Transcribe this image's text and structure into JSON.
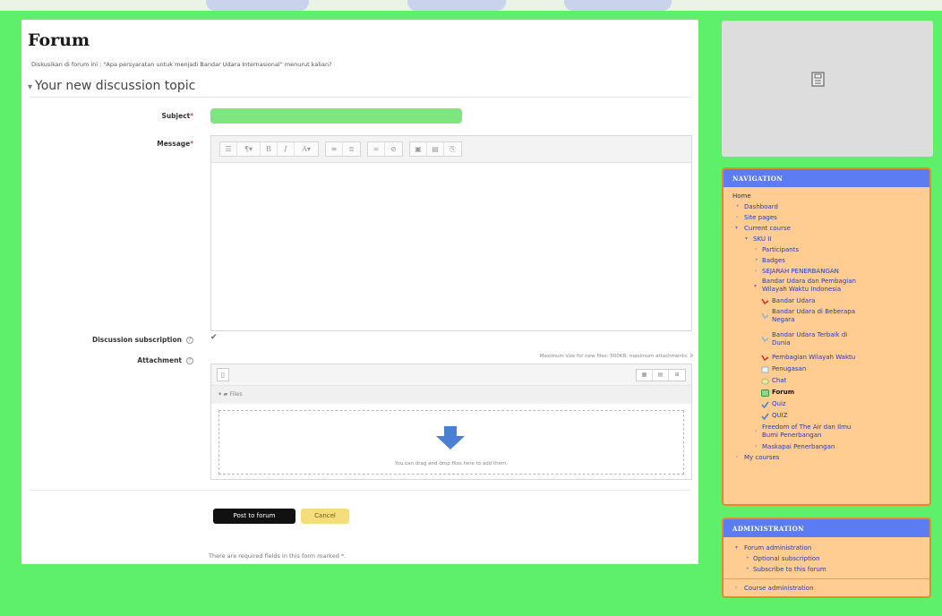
{
  "page": {
    "title": "Forum",
    "intro": "Diskusikan di forum ini : \"Apa persyaratan untuk menjadi Bandar Udara Internasional\" menurut kalian?",
    "section_title": "Your new discussion topic"
  },
  "form": {
    "subject_label": "Subject",
    "subject_value": "",
    "message_label": "Message",
    "required_marker": "*",
    "subscription_label": "Discussion subscription",
    "subscription_checked": true,
    "subscription_check_glyph": "✔",
    "attachment_label": "Attachment",
    "attachment_limits": "Maximum size for new files: 500KB, maximum attachments: 9",
    "files_path_label": "Files",
    "dropzone_text": "You can drag and drop files here to add them.",
    "post_button": "Post to forum",
    "cancel_button": "Cancel",
    "required_note": "There are required fields in this form marked *."
  },
  "editor_toolbar": {
    "groups": [
      [
        "toolbar-toggle",
        "font-style",
        "bold",
        "italic",
        "text-color"
      ],
      [
        "unordered-list",
        "ordered-list"
      ],
      [
        "link",
        "unlink"
      ],
      [
        "insert-image",
        "insert-media",
        "manage-files"
      ]
    ]
  },
  "navigation": {
    "header": "NAVIGATION",
    "home": "Home",
    "dashboard": "Dashboard",
    "site_pages": "Site pages",
    "current_course": "Current course",
    "course": "SKU II",
    "participants": "Participants",
    "badges": "Badges",
    "sejarah": "SEJARAH PENERBANGAN",
    "topic_line1": "Bandar Udara dan Pembagian",
    "topic_line2": "Wilayah Waktu Indonesia",
    "item_bandar": "Bandar Udara",
    "item_beberapa_1": "Bandar Udara di Beberapa",
    "item_beberapa_2": "Negara",
    "item_terbaik_1": "Bandar Udara Terbaik di",
    "item_terbaik_2": "Dunia",
    "item_pembagian": "Pembagian Wilayah Waktu",
    "item_penugasan": "Penugasan",
    "item_chat": "Chat",
    "item_forum": "Forum",
    "item_quiz": "Quiz",
    "item_quiz2": "QUIZ",
    "freedom_1": "Freedom of The Air dan Ilmu",
    "freedom_2": "Bumi Penerbangan",
    "maskapai": "Maskapai Penerbangan",
    "my_courses": "My courses"
  },
  "administration": {
    "header": "ADMINISTRATION",
    "forum_admin": "Forum administration",
    "optional_sub": "Optional subscription",
    "subscribe": "Subscribe to this forum",
    "course_admin": "Course administration"
  },
  "colors": {
    "page_background": "#5ef06a",
    "block_header": "#5b7cf2",
    "block_body": "#ffcc92",
    "post_button": "#111111",
    "cancel_button": "#f6dd7c",
    "subject_field": "#7fe67f"
  }
}
